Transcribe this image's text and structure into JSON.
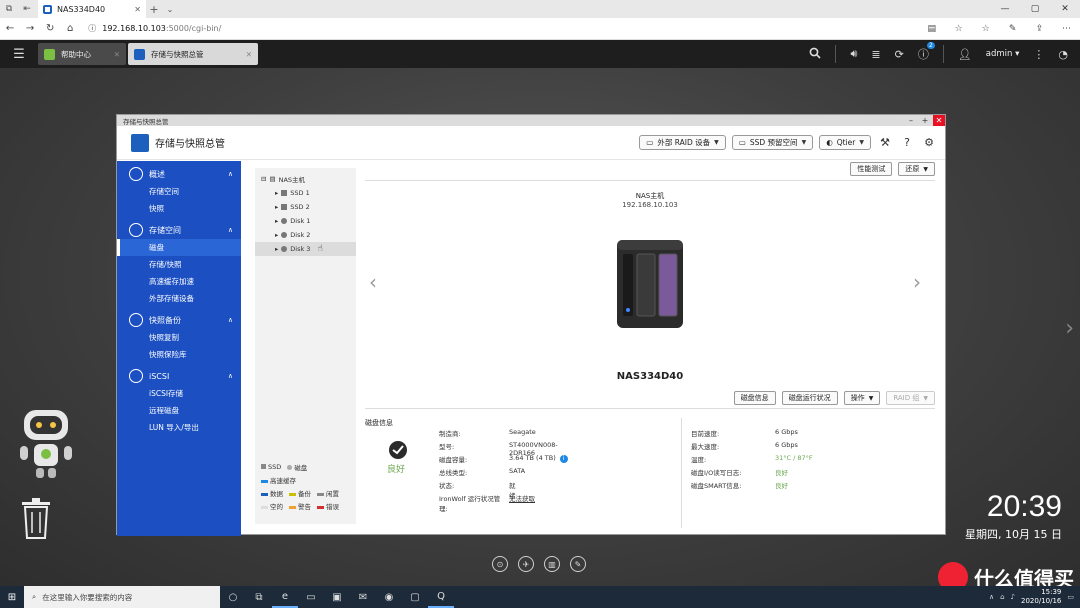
{
  "browser": {
    "tab_title": "NAS334D40",
    "tab_close": "✕",
    "new_tab": "+",
    "url_host": "192.168.10.103",
    "url_path": ":5000/cgi-bin/"
  },
  "qts": {
    "tabs": [
      {
        "label": "帮助中心"
      },
      {
        "label": "存储与快照总管"
      }
    ],
    "user": "admin ▾",
    "notif_count": "2"
  },
  "app": {
    "window_title": "存储与快照总管",
    "name": "存储与快照总管",
    "toolbar": {
      "raid": "外部 RAID 设备",
      "ssd": "SSD 预留空间",
      "qtier": "Qtier"
    },
    "sidebar": {
      "sections": [
        {
          "label": "概述",
          "items": [
            "存储空间",
            "快照"
          ]
        },
        {
          "label": "存储空间",
          "items": [
            "磁盘",
            "存储/快照",
            "高速缓存加速",
            "外部存储设备"
          ]
        },
        {
          "label": "快照备份",
          "items": [
            "快照复制",
            "快照保险库"
          ]
        },
        {
          "label": "iSCSI",
          "items": [
            "iSCSI存储",
            "远程磁盘",
            "LUN 导入/导出"
          ]
        }
      ]
    },
    "tree": {
      "root": "NAS主机",
      "nodes": [
        "SSD 1",
        "SSD 2",
        "Disk 1",
        "Disk 2",
        "Disk 3"
      ]
    },
    "legend": {
      "ssd": "SSD",
      "disk": "磁盘",
      "cache": "高速缓存",
      "data": "数据",
      "backup": "备份",
      "idle": "闲置",
      "empty": "空的",
      "warning": "警告",
      "error": "错误"
    },
    "main": {
      "perf_test": "性能测试",
      "restore": "还原",
      "nas_title": "NAS主机",
      "nas_ip": "192.168.10.103",
      "model": "NAS334D40",
      "btn_disk_info": "磁盘信息",
      "btn_disk_status": "磁盘运行状况",
      "btn_action": "操作",
      "btn_raid_group": "RAID 组",
      "info_title": "磁盘信息",
      "health": "良好",
      "left_info": [
        {
          "k": "制造商:",
          "v": "Seagate"
        },
        {
          "k": "型号:",
          "v": "ST4000VN008-2DR166"
        },
        {
          "k": "磁盘容量:",
          "v": "3.64 TB (4 TB)"
        },
        {
          "k": "总线类型:",
          "v": "SATA"
        },
        {
          "k": "状态:",
          "v": "就绪"
        },
        {
          "k": "IronWolf 运行状况管理:",
          "v": "无法获取"
        }
      ],
      "right_info": [
        {
          "k": "目前速度:",
          "v": "6 Gbps"
        },
        {
          "k": "最大速度:",
          "v": "6 Gbps"
        },
        {
          "k": "温度:",
          "v": "31°C / 87°F"
        },
        {
          "k": "磁盘I/O读写日志:",
          "v": "良好"
        },
        {
          "k": "磁盘SMART信息:",
          "v": "良好"
        }
      ]
    }
  },
  "desktop": {
    "time": "20:39",
    "date": "星期四, 10月 15 日"
  },
  "taskbar": {
    "search_placeholder": "在这里输入你要搜索的内容",
    "tray_time": "15:39",
    "tray_date": "2020/10/16"
  },
  "watermark": "什么值得买"
}
